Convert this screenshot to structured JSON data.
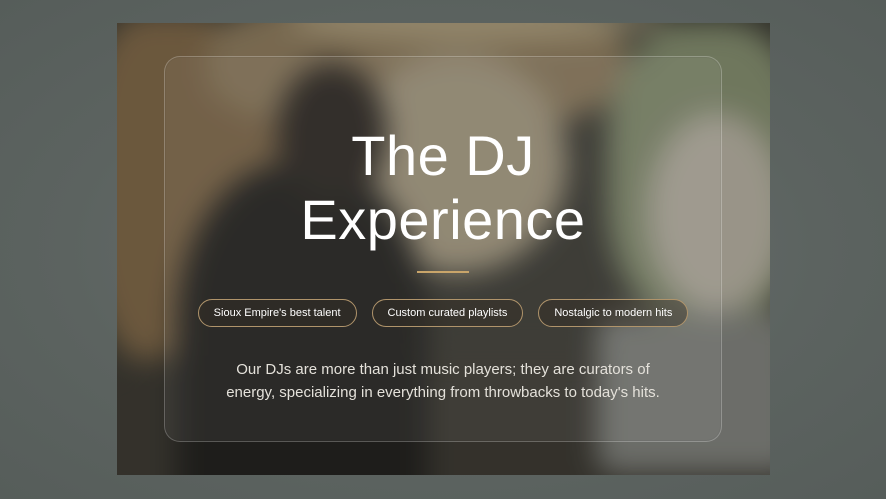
{
  "hero": {
    "title": "The DJ\nExperience",
    "description": "Our DJs are more than just music players; they are curators of energy, specializing in everything from throwbacks to today's hits.",
    "tags": [
      "Sioux Empire's best talent",
      "Custom curated playlists",
      "Nostalgic to modern hits"
    ]
  },
  "colors": {
    "page_background": "#5d6461",
    "accent_gold": "#c9a56a",
    "pill_border": "#b0946b",
    "title_text": "#ffffff",
    "body_text": "#e4e1da"
  }
}
